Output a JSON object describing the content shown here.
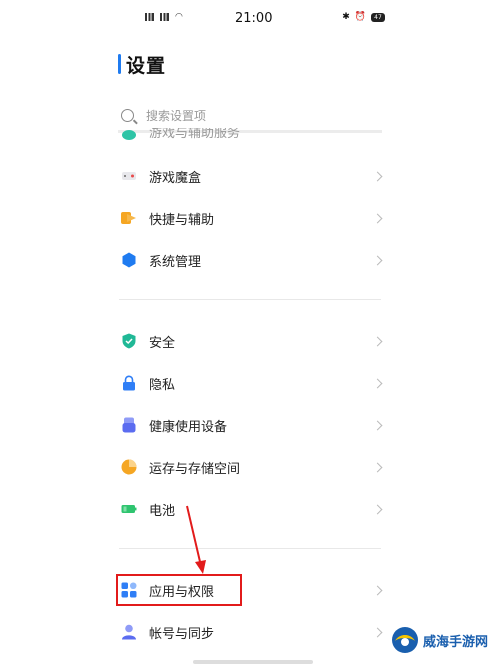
{
  "status_bar": {
    "left_info": "5G HD",
    "time": "21:00",
    "battery": "47"
  },
  "page": {
    "title": "设置",
    "search_placeholder": "搜索设置项"
  },
  "colors": {
    "accent": "#1f7bf0",
    "highlight": "#e21b1b",
    "annotation_arrow": "#e21b1b"
  },
  "partial_item": {
    "label": "游戏与辅助服务",
    "icon": "teal-icon"
  },
  "groups": [
    {
      "items": [
        {
          "label": "游戏魔盒",
          "icon": "game-box-icon",
          "color": "#e94b4b"
        },
        {
          "label": "快捷与辅助",
          "icon": "shortcut-arrow-icon",
          "color": "#f5a623"
        },
        {
          "label": "系统管理",
          "icon": "system-hexagon-icon",
          "color": "#1f7bf0"
        }
      ]
    },
    {
      "items": [
        {
          "label": "安全",
          "icon": "shield-icon",
          "color": "#20b896"
        },
        {
          "label": "隐私",
          "icon": "lock-icon",
          "color": "#2f7ef6"
        },
        {
          "label": "健康使用设备",
          "icon": "health-device-icon",
          "color": "#5b6cf0"
        },
        {
          "label": "运存与存储空间",
          "icon": "storage-pie-icon",
          "color": "#f5a623"
        },
        {
          "label": "电池",
          "icon": "battery-icon",
          "color": "#2ec46f"
        }
      ]
    },
    {
      "items": [
        {
          "label": "应用与权限",
          "icon": "apps-grid-icon",
          "color": "#2f7ef6",
          "highlighted": true
        },
        {
          "label": "帐号与同步",
          "icon": "account-icon",
          "color": "#5b6cf0"
        }
      ]
    }
  ],
  "watermark": {
    "text": "威海手游网"
  }
}
